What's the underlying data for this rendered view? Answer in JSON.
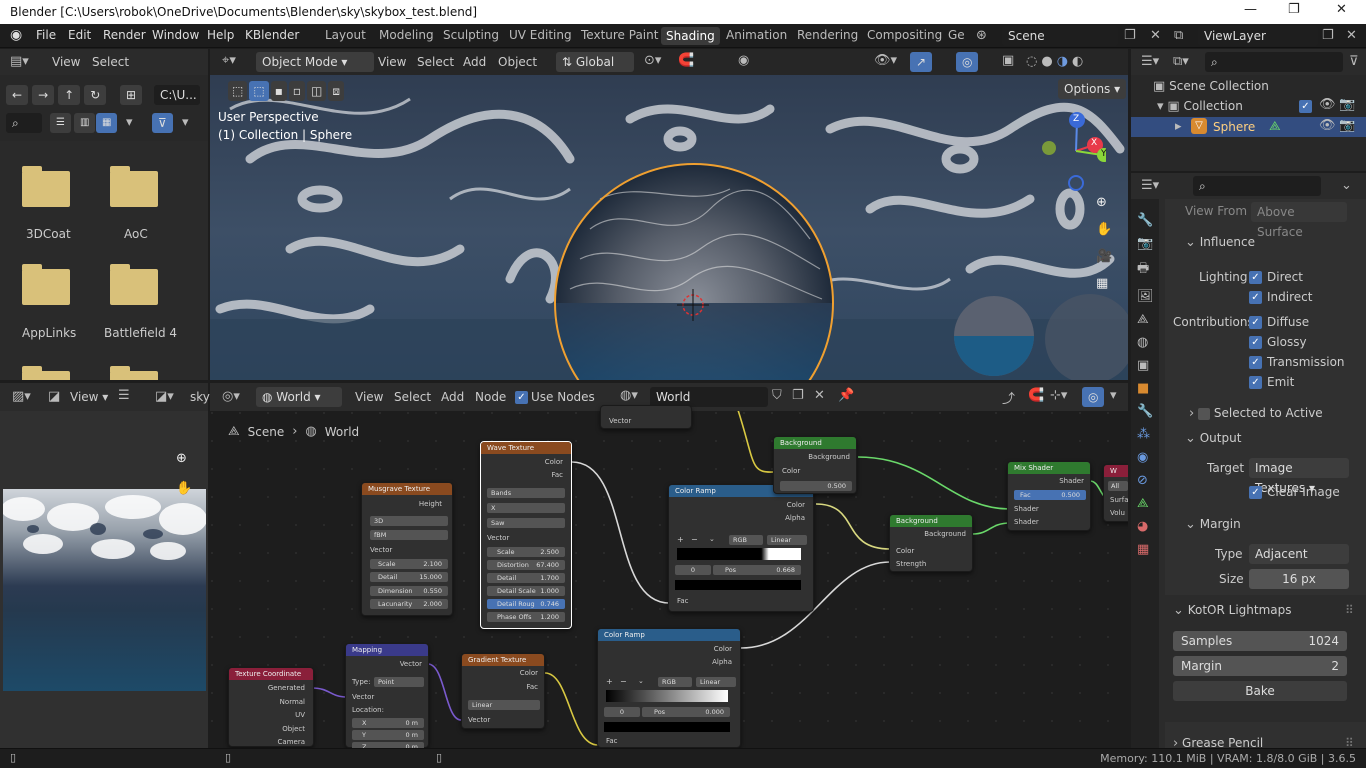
{
  "window": {
    "title": "Blender [C:\\Users\\robok\\OneDrive\\Documents\\Blender\\sky\\skybox_test.blend]",
    "min": "—",
    "max": "❐",
    "close": "✕"
  },
  "menu": [
    "File",
    "Edit",
    "Render",
    "Window",
    "Help",
    "KBlender"
  ],
  "workspaces": [
    "Layout",
    "Modeling",
    "Sculpting",
    "UV Editing",
    "Texture Paint",
    "Shading",
    "Animation",
    "Rendering",
    "Compositing",
    "Ge"
  ],
  "scene": "Scene",
  "view_layer": "ViewLayer",
  "filebrowser": {
    "view": "View",
    "select": "Select",
    "path": "C:\\U...",
    "items": [
      "3DCoat",
      "AoC",
      "AppLinks",
      "Battlefield 4"
    ]
  },
  "viewport": {
    "mode": "Object Mode",
    "menus": [
      "View",
      "Select",
      "Add",
      "Object"
    ],
    "orient": "Global",
    "options": "Options",
    "persp": "User Perspective",
    "coll": "(1) Collection | Sphere",
    "axes": [
      "Z",
      "X",
      "Y"
    ]
  },
  "image_editor": {
    "view": "View",
    "name": "sky"
  },
  "node_editor": {
    "world_type": "World",
    "menus": [
      "View",
      "Select",
      "Add",
      "Node"
    ],
    "use_nodes": "Use Nodes",
    "world_name": "World",
    "bc_scene": "Scene",
    "bc_world": "World"
  },
  "nodes": {
    "musgrave": {
      "title": "Musgrave Texture",
      "height": "Height",
      "dim": "3D",
      "type": "fBM",
      "vector": "Vector",
      "scale_l": "Scale",
      "scale": "2.100",
      "detail_l": "Detail",
      "detail": "15.000",
      "dimension_l": "Dimension",
      "dimension": "0.550",
      "lac_l": "Lacunarity",
      "lac": "2.000"
    },
    "wave": {
      "title": "Wave Texture",
      "color": "Color",
      "fac": "Fac",
      "bands": "Bands",
      "x": "X",
      "saw": "Saw",
      "vector": "Vector",
      "scale_l": "Scale",
      "scale": "2.500",
      "dist_l": "Distortion",
      "dist": "67.400",
      "detail_l": "Detail",
      "detail": "1.700",
      "dscale_l": "Detail Scale",
      "dscale": "1.000",
      "drough_l": "Detail Roug",
      "drough": "0.746",
      "phase_l": "Phase Offs",
      "phase": "1.200"
    },
    "ramp1": {
      "title": "Color Ramp",
      "color": "Color",
      "alpha": "Alpha",
      "rgb": "RGB",
      "linear": "Linear",
      "idx": "0",
      "pos_l": "Pos",
      "pos": "0.668",
      "fac": "Fac"
    },
    "bg1": {
      "title": "Background",
      "out": "Background",
      "color": "Color",
      "strength": "0.500"
    },
    "bg2": {
      "title": "Background",
      "out": "Background",
      "color": "Color",
      "strength": "Strength"
    },
    "mix": {
      "title": "Mix Shader",
      "shader": "Shader",
      "fac_l": "Fac",
      "fac": "0.500",
      "s1": "Shader",
      "s2": "Shader"
    },
    "wout": {
      "title": "W",
      "all": "All",
      "surf": "Surfa",
      "vol": "Volu"
    },
    "texcoord": {
      "title": "Texture Coordinate",
      "outs": [
        "Generated",
        "Normal",
        "UV",
        "Object",
        "Camera"
      ]
    },
    "mapping": {
      "title": "Mapping",
      "vector": "Vector",
      "type_l": "Type:",
      "type": "Point",
      "vin": "Vector",
      "loc": "Location:",
      "x_l": "X",
      "x": "0 m",
      "y_l": "Y",
      "y": "0 m",
      "z_l": "Z",
      "z": "0 m"
    },
    "gradient": {
      "title": "Gradient Texture",
      "color": "Color",
      "fac": "Fac",
      "linear": "Linear",
      "vector": "Vector"
    },
    "ramp2": {
      "title": "Color Ramp",
      "color": "Color",
      "alpha": "Alpha",
      "rgb": "RGB",
      "linear": "Linear",
      "idx": "0",
      "pos_l": "Pos",
      "pos": "0.000",
      "fac": "Fac"
    },
    "topvec": "Vector"
  },
  "outliner": {
    "scene_coll": "Scene Collection",
    "coll": "Collection",
    "sphere": "Sphere"
  },
  "props": {
    "view_from_l": "View From",
    "view_from": "Above Surface",
    "influence": "Influence",
    "lighting": "Lighting",
    "direct": "Direct",
    "indirect": "Indirect",
    "contributions": "Contributions",
    "diffuse": "Diffuse",
    "glossy": "Glossy",
    "transmission": "Transmission",
    "emit": "Emit",
    "sel_active": "Selected to Active",
    "output": "Output",
    "target_l": "Target",
    "target": "Image Textures",
    "clear": "Clear Image",
    "margin": "Margin",
    "type_l": "Type",
    "type": "Adjacent Faces",
    "size_l": "Size",
    "size": "16 px",
    "kotor": "KotOR Lightmaps",
    "samples_l": "Samples",
    "samples": "1024",
    "kmargin_l": "Margin",
    "kmargin": "2",
    "bake": "Bake",
    "grease": "Grease Pencil"
  },
  "status": "Memory: 110.1 MiB | VRAM: 1.8/8.0 GiB | 3.6.5",
  "colors": {
    "accent": "#4772b3",
    "selected_outline": "#f0a030",
    "texture_header": "#8a4a1f",
    "converter_header": "#2a5d8a",
    "shader_header": "#2f7a2f",
    "input_header": "#8a1f3a",
    "vector_header": "#3a3a8a"
  }
}
